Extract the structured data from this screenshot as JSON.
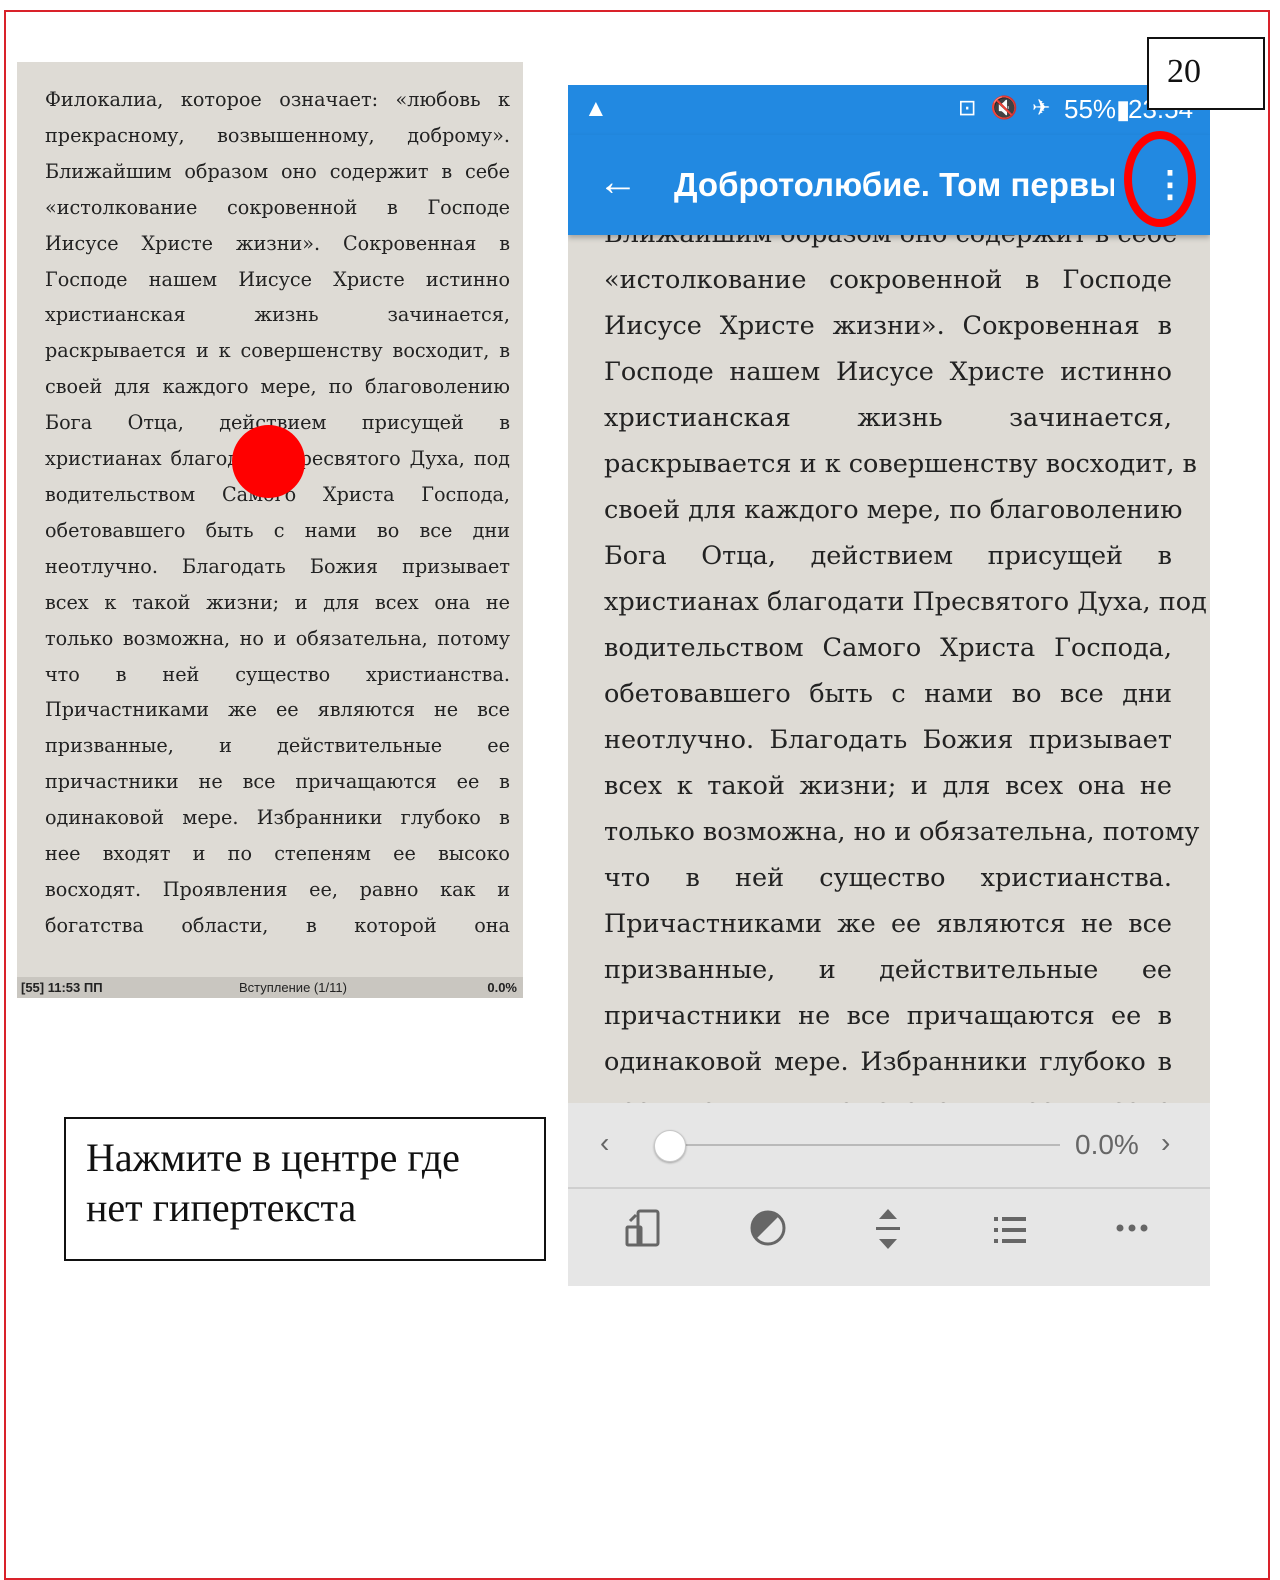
{
  "page": {
    "number": "20"
  },
  "instruction": {
    "line1": "Нажмите в центре где",
    "line2": "нет гипертекста"
  },
  "left_screen": {
    "text_lines": [
      "Филокалиа, которое означает: «любовь к",
      "прекрасному, возвышенному, доброму».",
      "Ближайшим образом оно содержит в себе",
      "«истолкование сокровенной в Господе",
      "Иисусе Христе жизни». Сокровенная в",
      "Господе нашем Иисусе Христе истинно",
      "христианская жизнь зачинается,",
      "раскрывается и к совершенству восходит, в",
      "своей для каждого мере, по благоволению",
      "Бога Отца, действием присущей в",
      "христианах благодати Пресвятого Духа, под",
      "водительством Самого Христа Господа,",
      "обетовавшего быть с нами во все дни",
      "неотлучно. Благодать Божия призывает",
      "всех к такой жизни; и для всех она не",
      "только возможна, но и обязательна, потому",
      "что в ней существо христианства.",
      "Причастниками же ее являются не все",
      "призванные, и действительные ее",
      "причастники не все причащаются ее в",
      "одинаковой мере. Избранники глубоко в",
      "нее входят и по степеням ее высоко",
      "восходят. Проявления ее, равно как и",
      "богатства области, в которой она"
    ],
    "status": {
      "time": "[55] 11:53 ПП",
      "chapter": "Вступление (1/11)",
      "percent": "0.0%"
    }
  },
  "right_screen": {
    "status_bar": {
      "icons": "⊡ 🔇 ✈",
      "battery": "55%▮",
      "time": "23:54"
    },
    "app_bar": {
      "back_icon": "arrow-back-icon",
      "title": "Добротолюбие. Том первы...",
      "more_icon": "more-vert-icon"
    },
    "text_lines": [
      "Ближайшим образом оно содержит в себе",
      "«истолкование сокровенной в Господе",
      "Иисусе Христе жизни». Сокровенная в",
      "Господе нашем Иисусе Христе истинно",
      "христианская жизнь зачинается,",
      "раскрывается и к совершенству восходит, в",
      "своей для каждого мере, по благоволению",
      "Бога Отца, действием присущей в",
      "христианах благодати Пресвятого Духа, под",
      "водительством Самого Христа Господа,",
      "обетовавшего быть с нами во все дни",
      "неотлучно. Благодать Божия призывает",
      "всех к такой жизни; и для всех она не",
      "только возможна, но и обязательна, потому",
      "что в ней существо христианства.",
      "Причастниками же ее являются не все",
      "призванные, и действительные ее",
      "причастники не все причащаются ее в",
      "одинаковой мере. Избранники глубоко в",
      "нее входят и по степеням ее высоко"
    ],
    "progress": {
      "value_fraction": 0.0,
      "label": "0.0%"
    },
    "toolbar": [
      {
        "icon": "screen-rotate-icon"
      },
      {
        "icon": "theme-contrast-icon"
      },
      {
        "icon": "line-spacing-icon"
      },
      {
        "icon": "table-of-contents-icon"
      },
      {
        "icon": "more-horiz-icon"
      }
    ]
  }
}
